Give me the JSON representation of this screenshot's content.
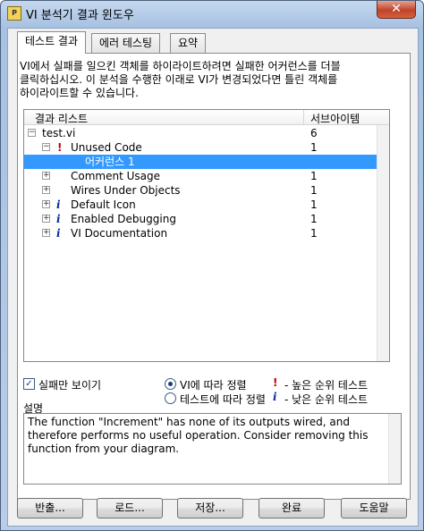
{
  "window": {
    "title": "VI 분석기 결과 윈도우",
    "close_glyph": "✕",
    "icon_glyph": "P"
  },
  "tabs": [
    {
      "label": "테스트 결과"
    },
    {
      "label": "에러 테스팅"
    },
    {
      "label": "요약"
    }
  ],
  "instructions": {
    "line1": "VI에서 실패를 일으킨 객체를 하이라이트하려면 실패한 어커런스를 더블",
    "line2": "클릭하십시오.  이 분석을 수행한 이래로 VI가 변경되었다면 틀린 객체를",
    "line3": "하이라이트할 수 있습니다."
  },
  "result_list": {
    "col_name": "결과 리스트",
    "col_subitems": "서브아이템",
    "rows": [
      {
        "name": "test.vi",
        "count": "6",
        "expander": "⊟",
        "marker": ""
      },
      {
        "name": "Unused Code",
        "count": "1",
        "expander": "⊟",
        "marker": "!"
      },
      {
        "name": "어커런스 1",
        "count": "",
        "expander": "",
        "marker": ""
      },
      {
        "name": "Comment Usage",
        "count": "1",
        "expander": "⊞",
        "marker": ""
      },
      {
        "name": "Wires Under Objects",
        "count": "1",
        "expander": "⊞",
        "marker": ""
      },
      {
        "name": "Default Icon",
        "count": "1",
        "expander": "⊞",
        "marker": "i"
      },
      {
        "name": "Enabled Debugging",
        "count": "1",
        "expander": "⊞",
        "marker": "i"
      },
      {
        "name": "VI Documentation",
        "count": "1",
        "expander": "⊞",
        "marker": "i"
      }
    ]
  },
  "options": {
    "show_failures_only": {
      "label": "실패만 보이기",
      "checked": true,
      "check_glyph": "✓"
    },
    "sort_by_vi": {
      "label": "VI에 따라 정렬",
      "selected": true
    },
    "sort_by_test": {
      "label": "테스트에 따라 정렬",
      "selected": false
    },
    "legend_high": {
      "mark": "!",
      "label": "- 높은 순위 테스트"
    },
    "legend_low": {
      "mark": "i",
      "label": "- 낮은 순위 테스트"
    }
  },
  "description": {
    "label": "설명",
    "text": "The function \"Increment\" has none of its outputs wired, and therefore performs no useful operation.  Consider removing this function from your diagram."
  },
  "buttons": {
    "export": "반출...",
    "load": "로드...",
    "save": "저장...",
    "done": "완료",
    "help": "도움말"
  }
}
